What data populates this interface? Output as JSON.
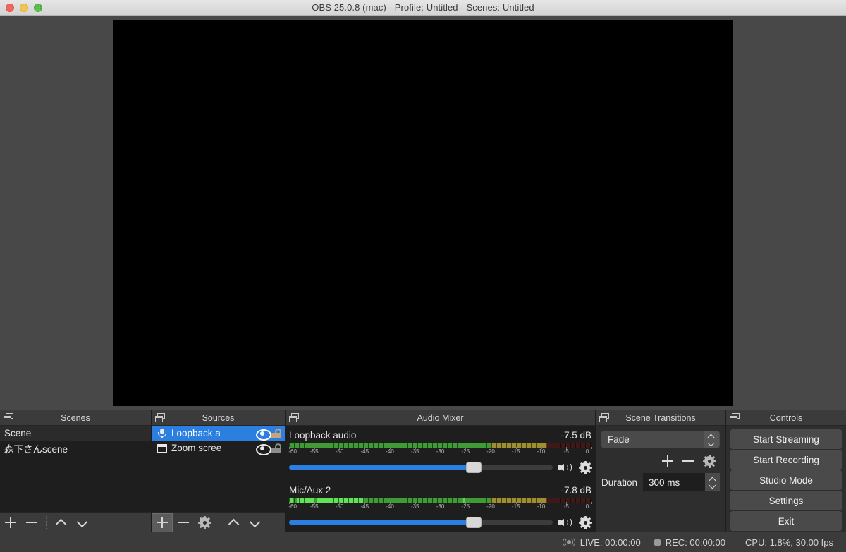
{
  "window": {
    "title": "OBS 25.0.8 (mac) - Profile: Untitled - Scenes: Untitled",
    "traffic_lights": [
      "close",
      "minimize",
      "maximize"
    ]
  },
  "preview": {
    "background_color": "#000000"
  },
  "docks": {
    "scenes": {
      "title": "Scenes",
      "items": [
        {
          "label": "Scene",
          "state": "current"
        },
        {
          "label": "森下さんscene",
          "state": "normal"
        }
      ],
      "toolbar": [
        {
          "name": "add-scene",
          "glyph": "plus"
        },
        {
          "name": "remove-scene",
          "glyph": "minus"
        },
        {
          "name": "move-scene-up",
          "glyph": "chevron-up"
        },
        {
          "name": "move-scene-down",
          "glyph": "chevron-down"
        }
      ]
    },
    "sources": {
      "title": "Sources",
      "items": [
        {
          "label": "Loopback a",
          "icon": "microphone-icon",
          "state": "selected",
          "visible": true,
          "locked": false
        },
        {
          "label": "Zoom scree",
          "icon": "window-capture-icon",
          "state": "normal",
          "visible": true,
          "locked": false
        }
      ],
      "toolbar": [
        {
          "name": "add-source",
          "glyph": "plus",
          "active": true
        },
        {
          "name": "remove-source",
          "glyph": "minus"
        },
        {
          "name": "source-properties",
          "glyph": "gear"
        },
        {
          "name": "move-source-up",
          "glyph": "chevron-up"
        },
        {
          "name": "move-source-down",
          "glyph": "chevron-down"
        }
      ]
    },
    "audio_mixer": {
      "title": "Audio Mixer",
      "scale_ticks": [
        "-60",
        "-55",
        "-50",
        "-45",
        "-40",
        "-35",
        "-30",
        "-25",
        "-20",
        "-15",
        "-10",
        "-5",
        "0"
      ],
      "scale_min": -60,
      "scale_max": 0,
      "tracks": [
        {
          "name": "Loopback audio",
          "db": "-7.5 dB",
          "level_db": -9.0,
          "peak_db": -60.0,
          "volume_percent": 70,
          "muted": false
        },
        {
          "name": "Mic/Aux 2",
          "db": "-7.8 dB",
          "level_db": -9.0,
          "peak_db": -25.5,
          "volume_percent": 70,
          "muted": false
        }
      ]
    },
    "scene_transitions": {
      "title": "Scene Transitions",
      "transition": "Fade",
      "duration_label": "Duration",
      "duration_value": "300 ms",
      "buttons": [
        {
          "name": "add-transition",
          "glyph": "plus"
        },
        {
          "name": "remove-transition",
          "glyph": "minus"
        },
        {
          "name": "transition-properties",
          "glyph": "gear"
        }
      ]
    },
    "controls": {
      "title": "Controls",
      "buttons": [
        "Start Streaming",
        "Start Recording",
        "Studio Mode",
        "Settings",
        "Exit"
      ]
    }
  },
  "statusbar": {
    "live": "LIVE: 00:00:00",
    "rec": "REC: 00:00:00",
    "cpu": "CPU: 1.8%, 30.00 fps"
  }
}
